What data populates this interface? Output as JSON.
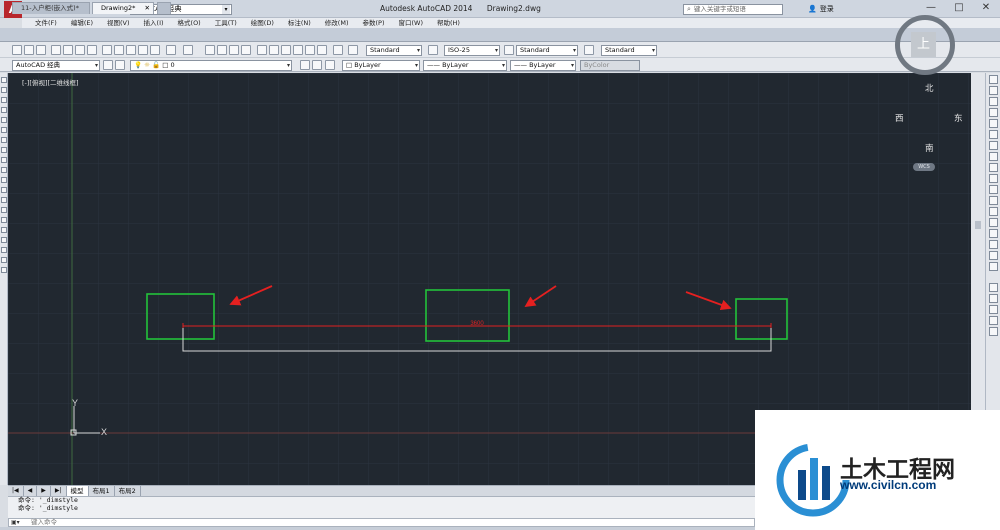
{
  "window": {
    "logo": "A",
    "title": "Autodesk AutoCAD 2014",
    "filename": "Drawing2.dwg",
    "workspace": "AutoCAD 经典",
    "search_placeholder": "键入关键字或短语",
    "login": "登录",
    "controls": [
      "—",
      "□",
      "✕"
    ]
  },
  "menu": [
    "文件(F)",
    "编辑(E)",
    "视图(V)",
    "插入(I)",
    "格式(O)",
    "工具(T)",
    "绘图(D)",
    "标注(N)",
    "修改(M)",
    "参数(P)",
    "窗口(W)",
    "帮助(H)"
  ],
  "tabs": [
    {
      "label": "11-入户柜(嵌入式)*"
    },
    {
      "label": "Drawing2*"
    }
  ],
  "toolbar": {
    "text_style": "Standard",
    "dim_style": "ISO-25",
    "table_style": "Standard",
    "mleader_style": "Standard",
    "workspace2": "AutoCAD 经典",
    "layer": "0",
    "color": "ByLayer",
    "linetype": "ByLayer",
    "lineweight": "ByLayer",
    "plotstyle": "ByColor"
  },
  "viewport": {
    "label": "[-][俯视][二维线框]",
    "compass_n": "北",
    "compass_s": "南",
    "compass_e": "东",
    "compass_w": "西",
    "cube_face": "上",
    "wcs": "WCS",
    "axis_x": "X",
    "axis_y": "Y",
    "dimension_text": "3600"
  },
  "colors": {
    "canvas": "#212830",
    "rect": "#22c23a",
    "dimension": "#e02121",
    "arrow": "#e52020",
    "line": "#d8d8d8"
  },
  "layout_tabs": [
    "模型",
    "布局1",
    "布局2"
  ],
  "command": {
    "history": [
      "命令:  '_dimstyle",
      "命令:  '_dimstyle"
    ],
    "placeholder": "键入命令",
    "prompt_icon": "command-icon"
  },
  "watermark": {
    "brand": "土木工程网",
    "url": "www.civilcn.com"
  }
}
